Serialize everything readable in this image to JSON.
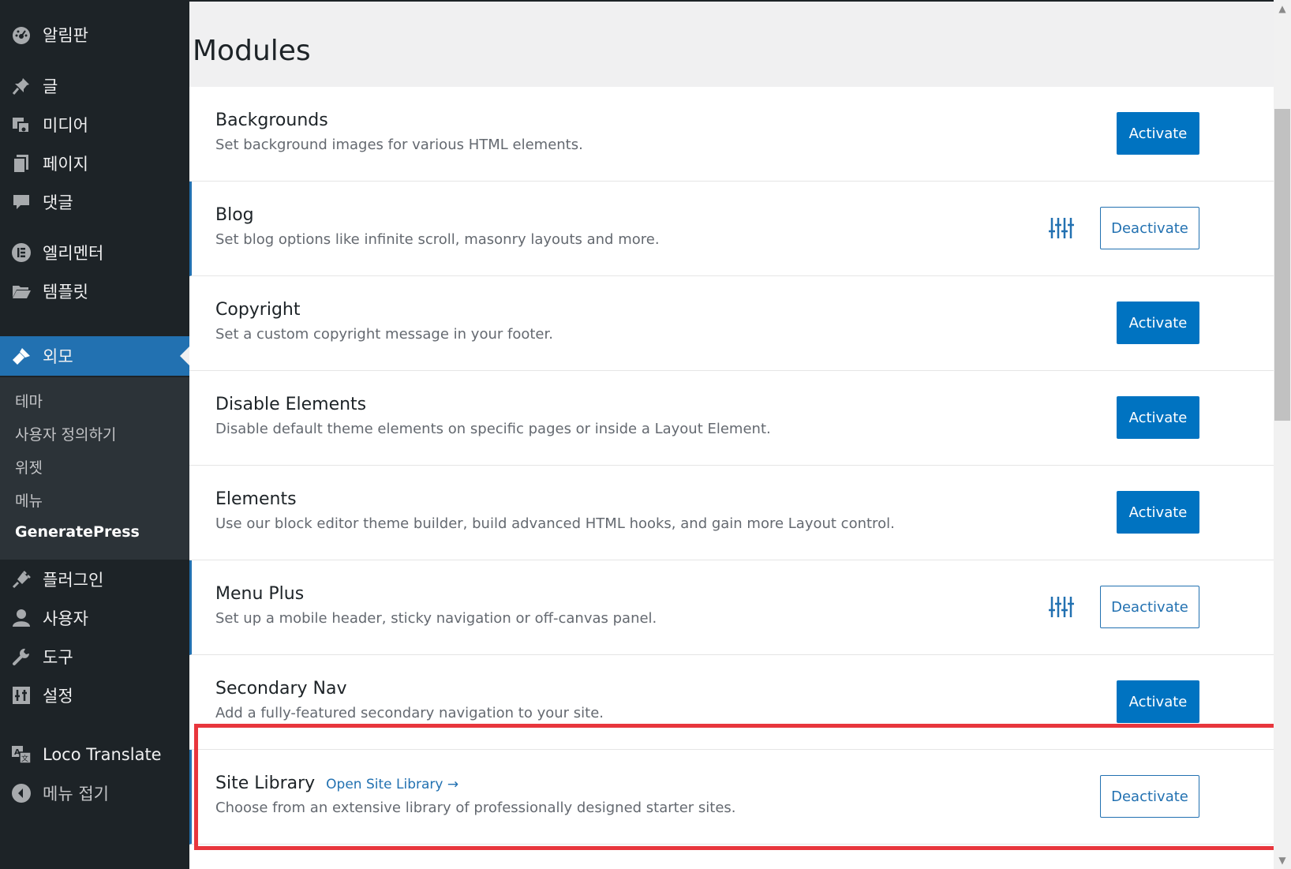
{
  "sidebar": {
    "items": [
      {
        "label": "알림판",
        "icon": "dashboard-icon"
      },
      {
        "label": "글",
        "icon": "pin-icon"
      },
      {
        "label": "미디어",
        "icon": "media-icon"
      },
      {
        "label": "페이지",
        "icon": "page-icon"
      },
      {
        "label": "댓글",
        "icon": "comment-icon"
      },
      {
        "label": "엘리멘터",
        "icon": "elementor-icon"
      },
      {
        "label": "템플릿",
        "icon": "folder-icon"
      },
      {
        "label": "외모",
        "icon": "appearance-icon"
      },
      {
        "label": "플러그인",
        "icon": "plugin-icon"
      },
      {
        "label": "사용자",
        "icon": "user-icon"
      },
      {
        "label": "도구",
        "icon": "wrench-icon"
      },
      {
        "label": "설정",
        "icon": "settings-icon"
      },
      {
        "label": "Loco Translate",
        "icon": "translate-icon"
      },
      {
        "label": "메뉴 접기",
        "icon": "collapse-icon"
      }
    ],
    "submenu": [
      "테마",
      "사용자 정의하기",
      "위젯",
      "메뉴",
      "GeneratePress"
    ]
  },
  "main": {
    "title": "Modules",
    "modules": [
      {
        "name": "Backgrounds",
        "desc": "Set background images for various HTML elements.",
        "button": "Activate"
      },
      {
        "name": "Blog",
        "desc": "Set blog options like infinite scroll, masonry layouts and more.",
        "button": "Deactivate"
      },
      {
        "name": "Copyright",
        "desc": "Set a custom copyright message in your footer.",
        "button": "Activate"
      },
      {
        "name": "Disable Elements",
        "desc": "Disable default theme elements on specific pages or inside a Layout Element.",
        "button": "Activate"
      },
      {
        "name": "Elements",
        "desc": "Use our block editor theme builder, build advanced HTML hooks, and gain more Layout control.",
        "button": "Activate"
      },
      {
        "name": "Menu Plus",
        "desc": "Set up a mobile header, sticky navigation or off-canvas panel.",
        "button": "Deactivate"
      },
      {
        "name": "Secondary Nav",
        "desc": "Add a fully-featured secondary navigation to your site.",
        "button": "Activate"
      },
      {
        "name": "Site Library",
        "link": "Open Site Library →",
        "desc": "Choose from an extensive library of professionally designed starter sites.",
        "button": "Deactivate"
      }
    ]
  },
  "colors": {
    "accent": "#2271b1",
    "highlight": "#e8363d",
    "sidebar": "#1d2327"
  }
}
